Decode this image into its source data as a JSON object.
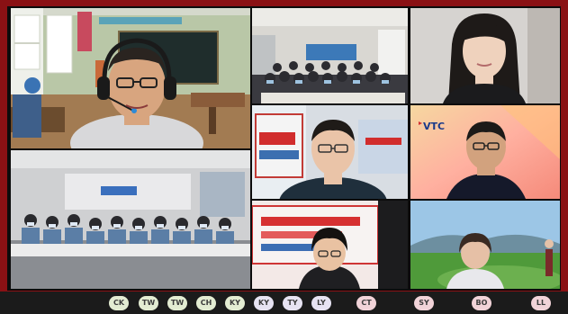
{
  "participants": [
    "CK",
    "TW",
    "TW",
    "CH",
    "KY",
    "KY",
    "TY",
    "LY",
    "CT",
    "SY",
    "BO",
    "LL"
  ],
  "badge_colors": [
    "#e3ecd2",
    "#e3ecd2",
    "#e3ecd2",
    "#e3ecd2",
    "#e3ecd2",
    "#e7e3f2",
    "#e7e3f2",
    "#e7e3f2",
    "#f1d3d8",
    "#f1d3d8",
    "#f1d3d8",
    "#f1d3d8"
  ],
  "vtc_logo": "VTC",
  "colors": {
    "background": "#8a1114",
    "grid": "#0c0c0c",
    "badge_bar": "#1b1b1b"
  }
}
